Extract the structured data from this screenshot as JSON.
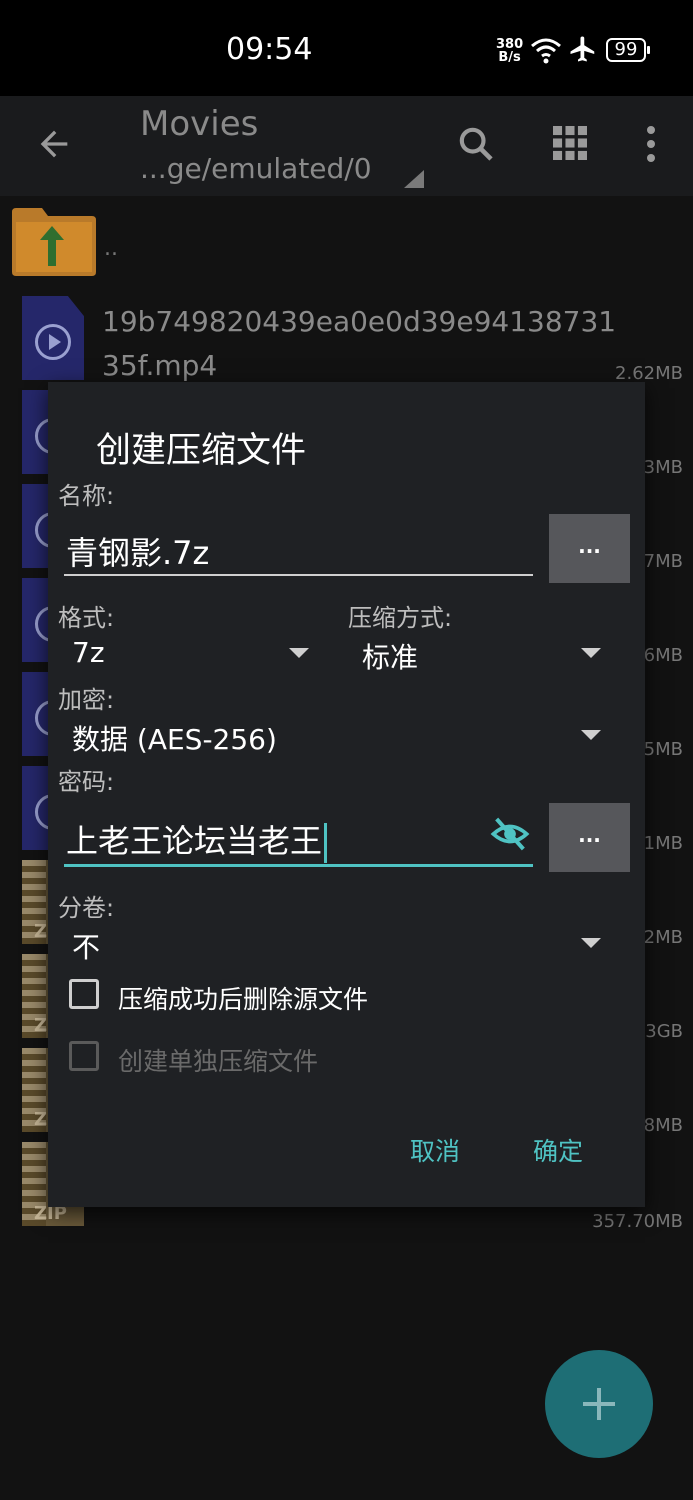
{
  "status_bar": {
    "time": "09:54",
    "net_speed_top": "380",
    "net_speed_bottom": "B/s",
    "battery": "99"
  },
  "app_bar": {
    "title": "Movies",
    "path": "...ge/emulated/0"
  },
  "file_list": {
    "up_label": "..",
    "files": [
      {
        "name": "19b749820439ea0e0d39e9413873135f.mp4",
        "size": "2.62MB",
        "type": "video"
      },
      {
        "size": "3MB",
        "type": "video"
      },
      {
        "size": "7MB",
        "type": "video"
      },
      {
        "size": "6MB",
        "type": "video"
      },
      {
        "size": "5MB",
        "type": "video"
      },
      {
        "size": "1MB",
        "type": "video"
      },
      {
        "size": "2MB",
        "type": "zip"
      },
      {
        "size": "3GB",
        "type": "zip"
      },
      {
        "size": "8MB",
        "type": "zip"
      },
      {
        "size": "357.70MB",
        "type": "zip",
        "icon_label": "ZIP"
      }
    ],
    "zip_label_short": "Z"
  },
  "dialog": {
    "title": "创建压缩文件",
    "name_label": "名称:",
    "name_value": "青钢影.7z",
    "ellipsis": "...",
    "format_label": "格式:",
    "format_value": "7z",
    "compression_label": "压缩方式:",
    "compression_value": "标准",
    "encryption_label": "加密:",
    "encryption_value": "数据 (AES-256)",
    "password_label": "密码:",
    "password_value": "上老王论坛当老王",
    "split_label": "分卷:",
    "split_value": "不",
    "delete_source_label": "压缩成功后删除源文件",
    "separate_archive_label": "创建单独压缩文件",
    "cancel_label": "取消",
    "ok_label": "确定"
  },
  "colors": {
    "accent": "#4fc3c3",
    "dialog_bg": "#1f2124",
    "fab": "#1e6e75"
  },
  "icons": [
    "back-arrow-icon",
    "search-icon",
    "grid-view-icon",
    "more-icon",
    "wifi-icon",
    "airplane-icon",
    "eye-off-icon",
    "plus-icon",
    "folder-up-icon",
    "video-file-icon",
    "zip-file-icon"
  ]
}
